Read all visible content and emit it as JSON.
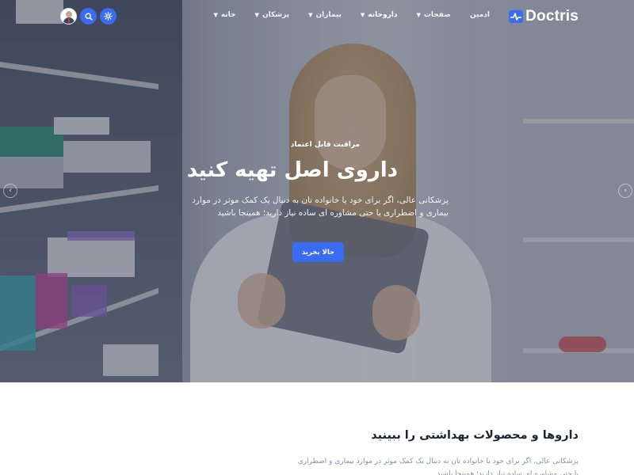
{
  "nav": {
    "logo_text": "Doctris",
    "menu": [
      {
        "label": "خانه",
        "has_dropdown": true,
        "active": false
      },
      {
        "label": "پزشکان",
        "has_dropdown": true,
        "active": false
      },
      {
        "label": "بیماران",
        "has_dropdown": true,
        "active": false
      },
      {
        "label": "داروخانه",
        "has_dropdown": true,
        "active": true
      },
      {
        "label": "صفحات",
        "has_dropdown": true,
        "active": false
      },
      {
        "label": "ادمین",
        "has_dropdown": false,
        "active": false
      }
    ],
    "icons": [
      "user-avatar",
      "search-icon",
      "gear-icon"
    ]
  },
  "hero": {
    "eyebrow": "مراقبت قابل اعتماد",
    "title": "داروی اصل تهیه کنید",
    "description": "پزشکانی عالی، اگر برای خود یا خانواده تان به دنبال یک کمک موثر در موارد بیماری و اضطراری یا حتی مشاوره ای ساده نیاز دارید؛ همینجا باشید",
    "cta_label": "حالا بخرید",
    "prev_arrow": "‹",
    "next_arrow": "›"
  },
  "section": {
    "title": "داروها و محصولات بهداشتی را ببینید",
    "description": "پزشکانی عالی، اگر برای خود یا خانواده تان به دنبال یک کمک موثر در موارد بیماری و اضطراری یا حتی مشاوره ای ساده نیاز دارید؛ همینجا باشید"
  },
  "colors": {
    "accent": "#396cf0",
    "text_dark": "#1d2433",
    "text_muted": "#8a91a0"
  }
}
